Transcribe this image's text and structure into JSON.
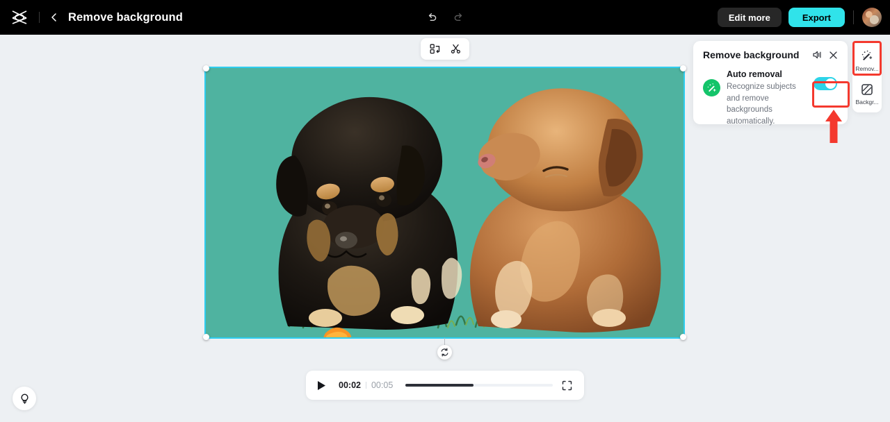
{
  "app": {
    "name": "CapCut",
    "background_color": "#edf0f3"
  },
  "topbar": {
    "logo_icon": "capcut-logo-icon",
    "back_icon": "chevron-left-icon",
    "project_title": "Remove background",
    "undo_icon": "undo-icon",
    "redo_icon": "redo-icon",
    "edit_more_label": "Edit more",
    "export_label": "Export",
    "export_color": "#30e3ea",
    "avatar_label": "avatar",
    "background_color": "#000000"
  },
  "mini_toolbar": {
    "crop_icon": "crop-split-icon",
    "cut_icon": "scissors-icon"
  },
  "canvas": {
    "media_description": "Two puppies — a black and tan puppy beside a brown puppy — sitting on grass",
    "background_color": "#4fb3a0",
    "selection_color": "#2ecdf0",
    "rotate_icon": "rotate-icon",
    "handles": [
      "top-left",
      "top-right",
      "bottom-left",
      "bottom-right"
    ]
  },
  "player": {
    "play_icon": "play-icon",
    "current_time": "00:02",
    "total_time": "00:05",
    "progress_percent": 46,
    "fullscreen_icon": "fullscreen-icon"
  },
  "panel": {
    "title": "Remove background",
    "volume_icon": "volume-icon",
    "close_icon": "close-icon",
    "option": {
      "badge_icon": "magic-wand-icon",
      "badge_color": "#14c46a",
      "title": "Auto removal",
      "description": "Recognize subjects and remove backgrounds automatically.",
      "toggle_on": true,
      "toggle_color": "#2dd4e8"
    }
  },
  "rail": {
    "items": [
      {
        "icon": "magic-wand-icon",
        "label": "Remov...",
        "active": true
      },
      {
        "icon": "background-pattern-icon",
        "label": "Backgr...",
        "active": false
      }
    ]
  },
  "annotations": {
    "highlight_color": "#f4392e",
    "arrow_icon": "up-arrow-annotation"
  },
  "help": {
    "icon": "lightbulb-icon"
  }
}
